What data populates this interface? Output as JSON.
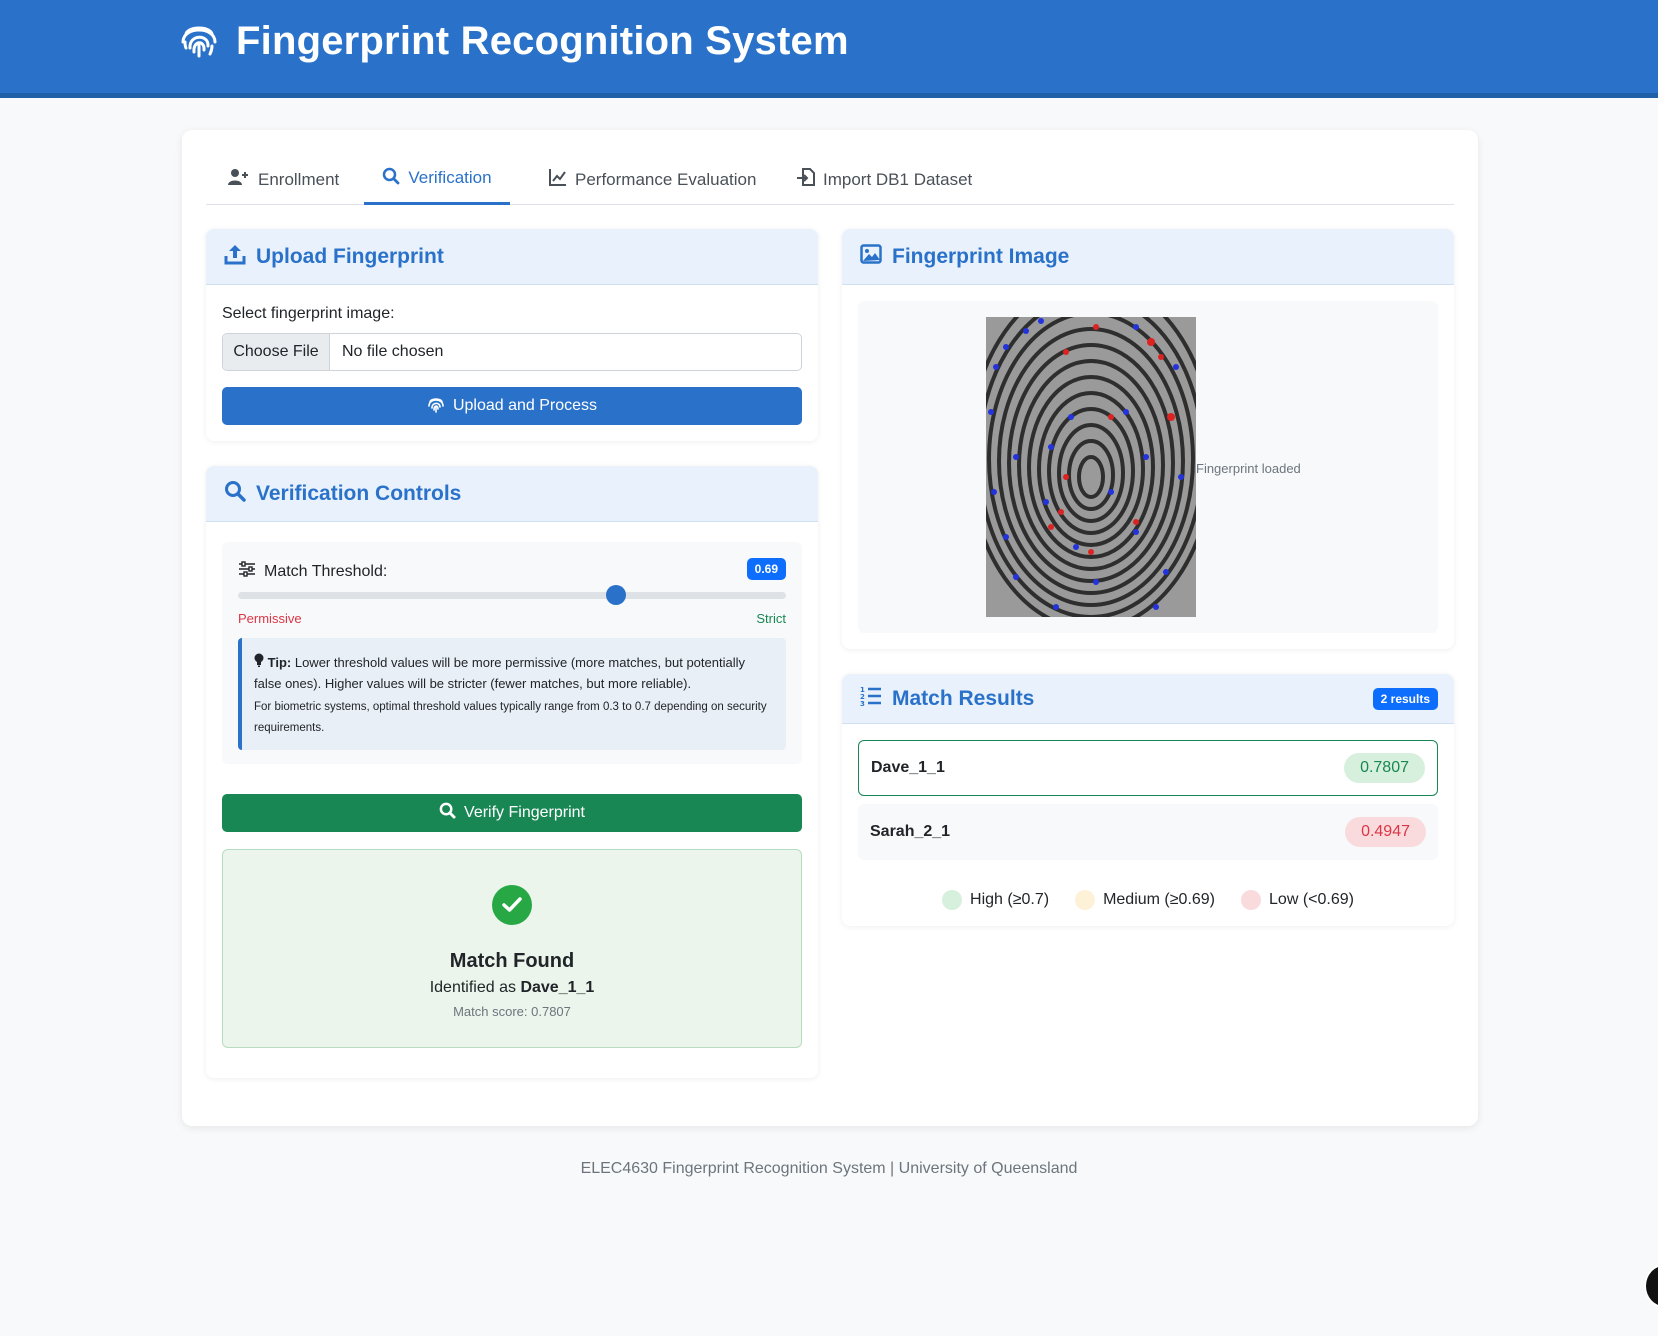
{
  "header": {
    "title": "Fingerprint Recognition System"
  },
  "tabs": [
    {
      "label": "Enrollment",
      "icon": "user-plus-icon"
    },
    {
      "label": "Verification",
      "icon": "search-icon",
      "active": true
    },
    {
      "label": "Performance Evaluation",
      "icon": "line-chart-icon"
    },
    {
      "label": "Import DB1 Dataset",
      "icon": "file-import-icon"
    }
  ],
  "upload": {
    "title": "Upload Fingerprint",
    "select_label": "Select fingerprint image:",
    "choose_file": "Choose File",
    "no_file": "No file chosen",
    "button": "Upload and Process"
  },
  "controls": {
    "title": "Verification Controls",
    "threshold_label": "Match Threshold:",
    "threshold_value": "0.69",
    "threshold_fraction": 0.69,
    "permissive": "Permissive",
    "strict": "Strict",
    "tip_bold": "Tip:",
    "tip_text": "Lower threshold values will be more permissive (more matches, but potentially false ones). Higher values will be stricter (fewer matches, but more reliable).",
    "tip_small": "For biometric systems, optimal threshold values typically range from 0.3 to 0.7 depending on security requirements.",
    "verify_button": "Verify Fingerprint"
  },
  "result": {
    "title": "Match Found",
    "identified_prefix": "Identified as",
    "identified_name": "Dave_1_1",
    "score_text": "Match score: 0.7807"
  },
  "image_panel": {
    "title": "Fingerprint Image",
    "caption": "Fingerprint loaded"
  },
  "matches": {
    "title": "Match Results",
    "count": "2 results",
    "rows": [
      {
        "name": "Dave_1_1",
        "score": "0.7807",
        "level": "high"
      },
      {
        "name": "Sarah_2_1",
        "score": "0.4947",
        "level": "low"
      }
    ],
    "legend": [
      {
        "label": "High (≥0.7)",
        "color": "#d7f0dd"
      },
      {
        "label": "Medium (≥0.69)",
        "color": "#fdf1d8"
      },
      {
        "label": "Low (<0.69)",
        "color": "#f9dbde"
      }
    ]
  },
  "footer": {
    "text": "ELEC4630 Fingerprint Recognition System | University of Queensland"
  },
  "colors": {
    "primary": "#2a72c9",
    "success": "#198754",
    "danger": "#dc3545"
  }
}
